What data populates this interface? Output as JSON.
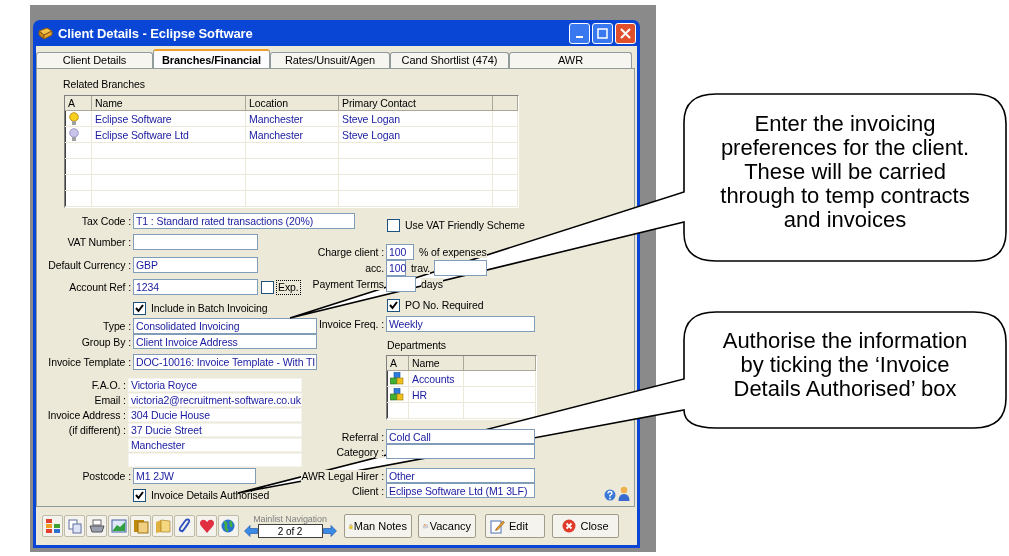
{
  "window": {
    "title": "Client Details - Eclipse Software"
  },
  "tabs": [
    {
      "label": "Client Details",
      "selected": false
    },
    {
      "label": "Branches/Financial",
      "selected": true
    },
    {
      "label": "Rates/Unsuit/Agen",
      "selected": false
    },
    {
      "label": "Cand Shortlist (474)",
      "selected": false
    },
    {
      "label": "AWR",
      "selected": false
    }
  ],
  "related_branches": {
    "title": "Related Branches",
    "columns": [
      "A",
      "Name",
      "Location",
      "Primary Contact"
    ],
    "rows": [
      {
        "active": true,
        "name": "Eclipse Software",
        "location": "Manchester",
        "primary_contact": "Steve Logan"
      },
      {
        "active": false,
        "name": "Eclipse Software Ltd",
        "location": "Manchester",
        "primary_contact": "Steve Logan"
      }
    ]
  },
  "tax_code": {
    "label": "Tax Code :",
    "value": "T1 : Standard rated transactions (20%)"
  },
  "vat_number": {
    "label": "VAT Number :"
  },
  "default_currency": {
    "label": "Default Currency :",
    "value": "GBP"
  },
  "account_ref": {
    "label": "Account Ref :",
    "value": "1234",
    "exp": {
      "label": "Exp.",
      "checked": false
    }
  },
  "batch_invoicing": {
    "label": "Include in Batch Invoicing",
    "checked": true
  },
  "type": {
    "label": "Type :",
    "value": "Consolidated Invoicing"
  },
  "group_by": {
    "label": "Group By :",
    "value": "Client Invoice Address"
  },
  "invoice_template": {
    "label": "Invoice Template :",
    "value": "DOC-10016: Invoice Template - With TI"
  },
  "contact_block": [
    {
      "label": "F.A.O. :",
      "value": "Victoria Royce"
    },
    {
      "label": "Email :",
      "value": "victoria2@recruitment-software.co.uk"
    },
    {
      "label": "Invoice Address :",
      "value": "304 Ducie House"
    },
    {
      "label": "(if different) :",
      "value": "37 Ducie Street"
    },
    {
      "value": "Manchester"
    }
  ],
  "postcode": {
    "label": "Postcode :",
    "value": "M1 2JW"
  },
  "invoice_details_authorised": {
    "label": "Invoice Details Authorised",
    "checked": true
  },
  "vat_friendly": {
    "label": "Use VAT Friendly Scheme",
    "checked": false
  },
  "charge_client": {
    "label": "Charge client :",
    "value": "100",
    "suffix": "% of expenses"
  },
  "acc": {
    "label": "acc.",
    "value": "100",
    "trav_label": "trav."
  },
  "payment_terms": {
    "label": "Payment Terms",
    "suffix": "days"
  },
  "po_required": {
    "label": "PO No. Required",
    "checked": true
  },
  "invoice_freq": {
    "label": "Invoice Freq. :",
    "value": "Weekly"
  },
  "departments": {
    "title": "Departments",
    "columns": [
      "A",
      "Name"
    ],
    "rows": [
      {
        "name": "Accounts"
      },
      {
        "name": "HR"
      }
    ]
  },
  "referral": {
    "label": "Referral :",
    "value": "Cold Call"
  },
  "category": {
    "label": "Category :"
  },
  "awr_legal_hirer": {
    "label": "AWR Legal Hirer :",
    "value": "Other"
  },
  "client": {
    "label": "Client :",
    "value": "Eclipse Software Ltd (M1 3LF)"
  },
  "navigation": {
    "label": "Mainlist Navigation",
    "position": "2 of 2"
  },
  "buttons": [
    {
      "kind": "notes",
      "label": "Man Notes"
    },
    {
      "kind": "vacancy",
      "label": "Vacancy"
    },
    {
      "kind": "edit",
      "label": "Edit"
    },
    {
      "kind": "close",
      "label": "Close"
    }
  ],
  "callouts": [
    {
      "text": "Enter the invoicing preferences for the client. These will be carried through to temp contracts and invoices"
    },
    {
      "text": "Authorise the information by ticking the ‘Invoice Details Authorised’ box"
    }
  ]
}
